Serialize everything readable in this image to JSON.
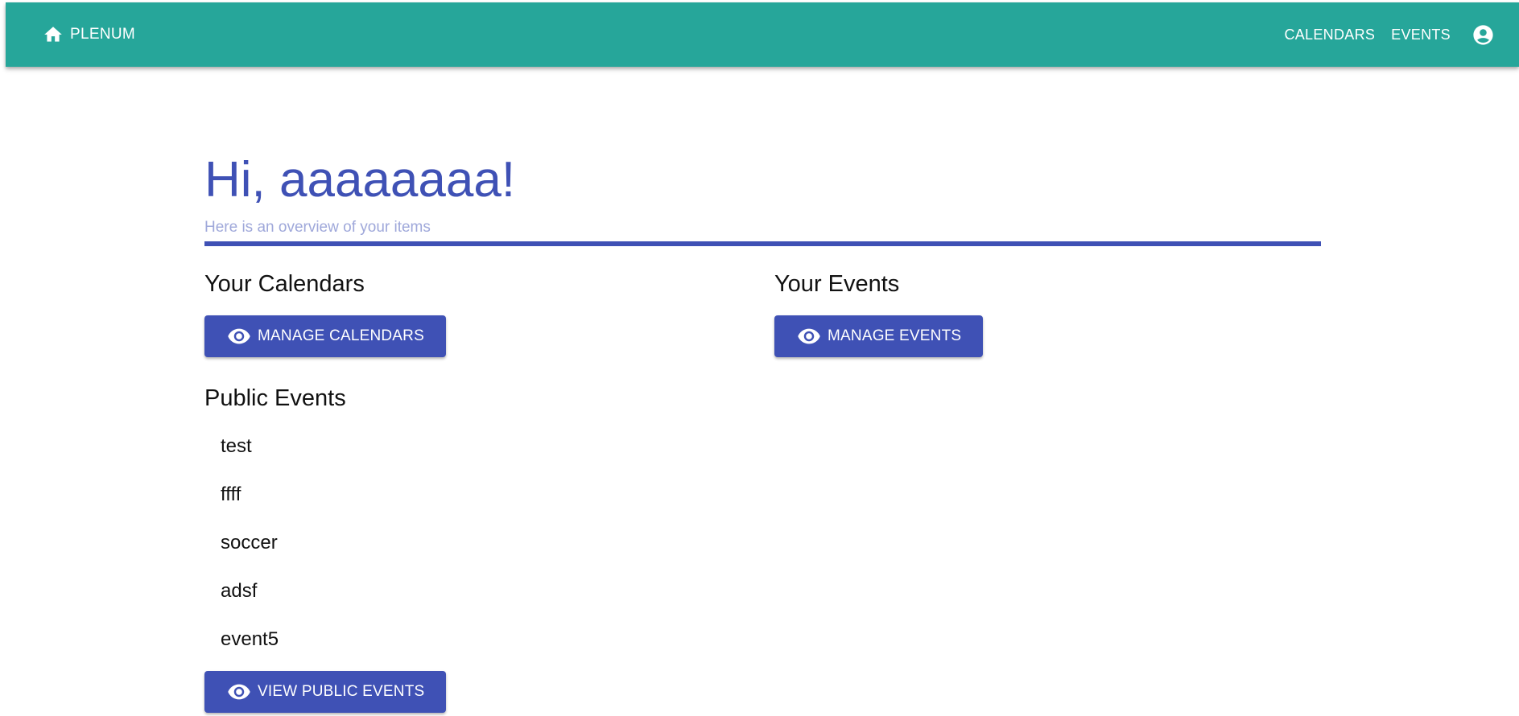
{
  "appbar": {
    "brand": "PLENUM",
    "nav": {
      "calendars": "CALENDARS",
      "events": "EVENTS"
    },
    "icons": {
      "home": "home-icon",
      "account": "account-circle-icon"
    },
    "background_color": "#26a69a"
  },
  "overview": {
    "greeting": "Hi, aaaaaaaa!",
    "subtitle": "Here is an overview of your items",
    "accent_color": "#3f51b5"
  },
  "calendars_section": {
    "title": "Your Calendars",
    "button_label": "MANAGE CALENDARS"
  },
  "events_section": {
    "title": "Your Events",
    "button_label": "MANAGE EVENTS"
  },
  "public_events_section": {
    "title": "Public Events",
    "items": [
      "test",
      "ffff",
      "soccer",
      "adsf",
      "event5"
    ],
    "button_label": "VIEW PUBLIC EVENTS"
  }
}
